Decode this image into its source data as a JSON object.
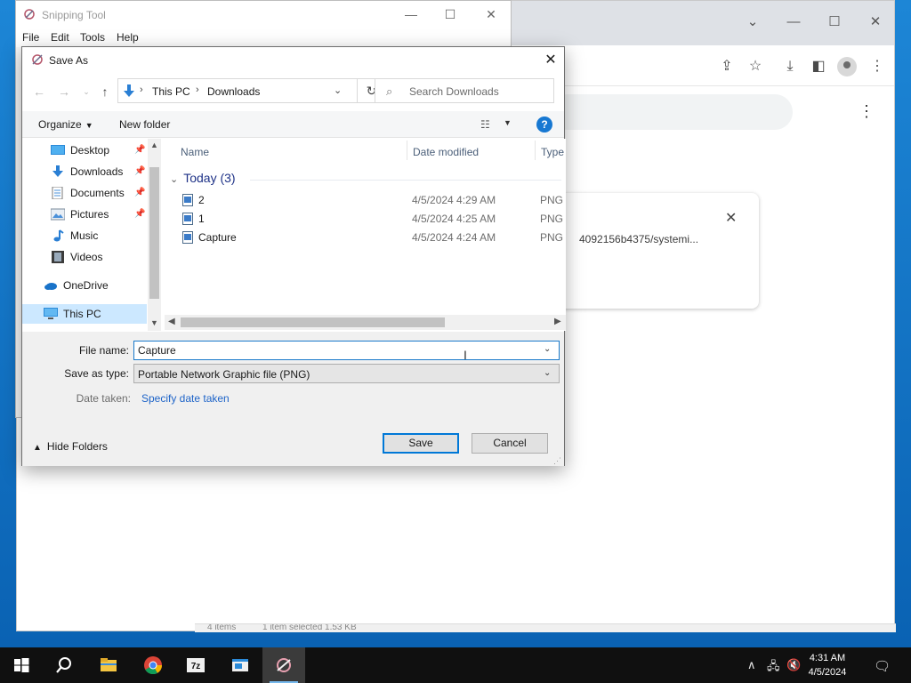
{
  "snipping_tool": {
    "title": "Snipping Tool",
    "menu": [
      "File",
      "Edit",
      "Tools",
      "Help"
    ]
  },
  "chrome": {
    "download_card_text": "4092156b4375/systemi...",
    "status_items": "4 items",
    "status_selected": "1 item selected  1.53 KB"
  },
  "dialog": {
    "title": "Save As",
    "breadcrumb": [
      "This PC",
      "Downloads"
    ],
    "search_placeholder": "Search Downloads",
    "toolbar": {
      "organize": "Organize",
      "new_folder": "New folder"
    },
    "nav_items": [
      {
        "label": "Desktop",
        "icon": "desktop-icon",
        "pinned": true
      },
      {
        "label": "Downloads",
        "icon": "downloads-icon",
        "pinned": true
      },
      {
        "label": "Documents",
        "icon": "documents-icon",
        "pinned": true
      },
      {
        "label": "Pictures",
        "icon": "pictures-icon",
        "pinned": true
      },
      {
        "label": "Music",
        "icon": "music-icon",
        "pinned": false
      },
      {
        "label": "Videos",
        "icon": "videos-icon",
        "pinned": false
      },
      {
        "label": "OneDrive",
        "icon": "onedrive-icon",
        "pinned": false
      },
      {
        "label": "This PC",
        "icon": "this-pc-icon",
        "pinned": false,
        "selected": true
      }
    ],
    "columns": [
      "Name",
      "Date modified",
      "Type"
    ],
    "group": "Today (3)",
    "files": [
      {
        "name": "2",
        "date": "4/5/2024 4:29 AM",
        "type": "PNG"
      },
      {
        "name": "1",
        "date": "4/5/2024 4:25 AM",
        "type": "PNG"
      },
      {
        "name": "Capture",
        "date": "4/5/2024 4:24 AM",
        "type": "PNG"
      }
    ],
    "file_name_label": "File name:",
    "file_name_value": "Capture",
    "save_type_label": "Save as type:",
    "save_type_value": "Portable Network Graphic file (PNG)",
    "date_taken_label": "Date taken:",
    "date_taken_link": "Specify date taken",
    "hide_folders": "Hide Folders",
    "save_button": "Save",
    "cancel_button": "Cancel"
  },
  "taskbar": {
    "time": "4:31 AM",
    "date": "4/5/2024"
  },
  "colors": {
    "accent": "#0078d7",
    "selection": "#cce8ff",
    "link": "#1e64c8",
    "group_header": "#1e3287"
  }
}
